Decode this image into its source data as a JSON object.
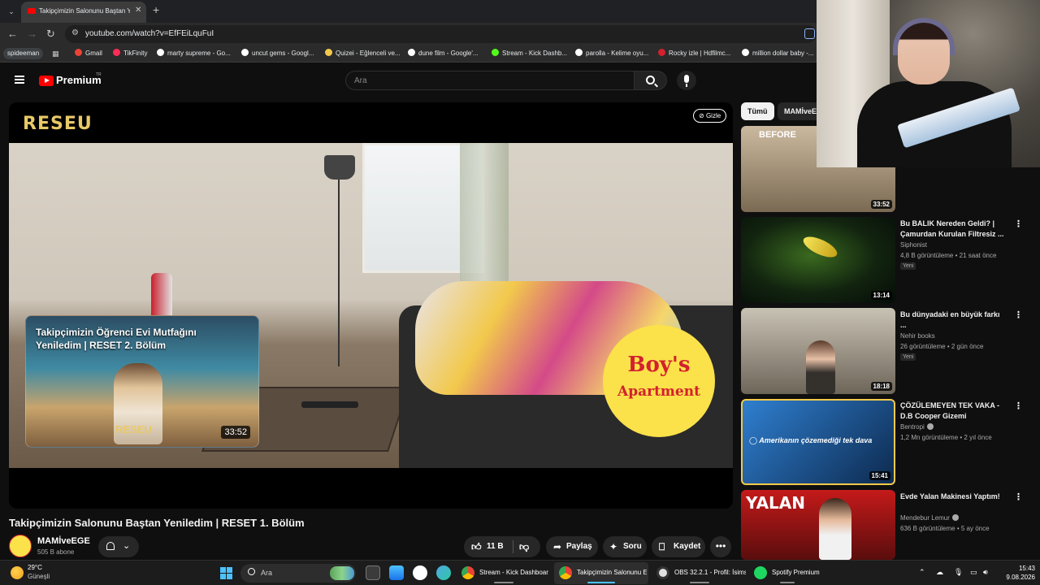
{
  "browser": {
    "tab_title": "Takipçimizin Salonunu Baştan Y",
    "url": "youtube.com/watch?v=EfFEiLquFuI",
    "profile": "spideeman",
    "bookmarks": [
      {
        "label": "Gmail",
        "color": "#ea4335"
      },
      {
        "label": "TikFinity",
        "color": "#ff2d55"
      },
      {
        "label": "marty supreme - Go...",
        "color": "#ffffff"
      },
      {
        "label": "uncut gems - Googl...",
        "color": "#ffffff"
      },
      {
        "label": "Quizei - Eğlenceli ve...",
        "color": "#f2c94c"
      },
      {
        "label": "dune film - Google'...",
        "color": "#ffffff"
      },
      {
        "label": "Stream - Kick Dashb...",
        "color": "#53fc18"
      },
      {
        "label": "parolla - Kelime oyu...",
        "color": "#ffffff"
      },
      {
        "label": "Rocky izle | Hdfilmc...",
        "color": "#d3212e"
      },
      {
        "label": "million dollar baby -...",
        "color": "#ffffff"
      }
    ]
  },
  "youtube": {
    "brand": "Premium",
    "brand_sup": "TR",
    "search_placeholder": "Ara"
  },
  "player": {
    "logo_text": "RESEU",
    "hide_label": "Gizle",
    "end_card": {
      "title": "Takipçimizin Öğrenci Evi Mutfağını Yeniledim | RESET 2. Bölüm",
      "duration": "33:52",
      "reset_logo": "RESEU"
    },
    "sponsor_line1": "Boy's",
    "sponsor_line2": "Apartment"
  },
  "video": {
    "title": "Takipçimizin Salonunu Baştan Yeniledim | RESET 1. Bölüm",
    "channel": "MAMİveEGE",
    "subscribers": "505 B abone",
    "likes": "11 B",
    "share": "Paylaş",
    "ask": "Soru",
    "save": "Kaydet"
  },
  "sidebar": {
    "chips": [
      "Tümü",
      "MAMİveEGE"
    ],
    "items": [
      {
        "title": "",
        "channel": "",
        "meta": "",
        "badge": "",
        "duration": "33:52",
        "thumb_top": "#cbb99f",
        "thumb_bottom": "#7b6a53"
      },
      {
        "title": "Bu BALIK Nereden Geldi? | Çamurdan Kurulan Filtresiz ...",
        "channel": "Siphonist",
        "meta": "4,8 B görüntüleme • 21 saat önce",
        "badge": "Yeni",
        "duration": "13:14",
        "thumb_top": "#0b1a12",
        "thumb_bottom": "#1f3d18"
      },
      {
        "title": "Bu dünyadaki en büyük farkı ...",
        "channel": "Nehir books",
        "meta": "26 görüntüleme • 2 gün önce",
        "badge": "Yeni",
        "duration": "18:18",
        "thumb_top": "#c8c2b4",
        "thumb_bottom": "#6e6559"
      },
      {
        "title": "ÇÖZÜLEMEYEN TEK VAKA - D.B Cooper Gizemi",
        "channel": "Bentropi",
        "meta": "1,2 Mn görüntüleme • 2 yıl önce",
        "badge": "",
        "duration": "15:41",
        "thumb_top": "#1d5fa8",
        "thumb_bottom": "#0d2a4f"
      },
      {
        "title": "Evde Yalan Makinesi Yaptım!",
        "channel": "Mendebur Lemur",
        "meta": "636 B görüntüleme • 5 ay önce",
        "badge": "",
        "duration": "",
        "thumb_top": "#c51a1a",
        "thumb_bottom": "#5a0d0d"
      }
    ]
  },
  "taskbar": {
    "temperature": "29°C",
    "condition": "Güneşli",
    "search_label": "Ara",
    "tasks": [
      {
        "label": "Stream - Kick Dashboar",
        "color": "#1a73e8",
        "active": false
      },
      {
        "label": "Takipçimizin Salonunu E",
        "color": "#1a73e8",
        "active": true
      },
      {
        "label": "OBS 32.2.1 - Profil: İsims",
        "color": "#e0e0e0",
        "active": false
      },
      {
        "label": "Spotify Premium",
        "color": "#1ed760",
        "active": false
      }
    ],
    "time": "15:43",
    "date": "9.08.2026"
  }
}
